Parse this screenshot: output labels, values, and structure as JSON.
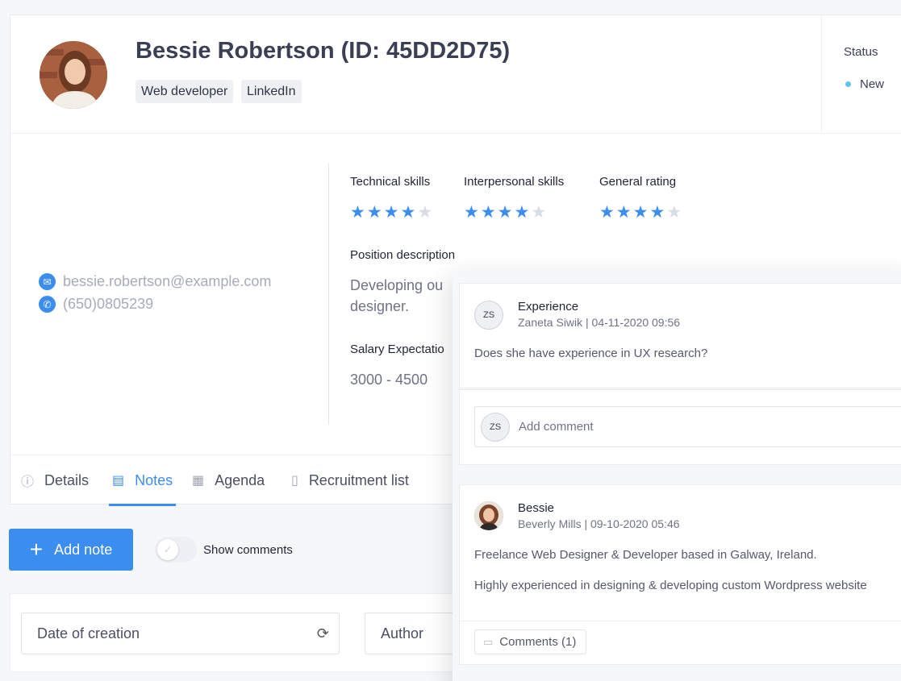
{
  "candidate": {
    "name": "Bessie Robertson (ID: 45DD2D75)",
    "tags": [
      "Web developer",
      "LinkedIn"
    ],
    "status_label": "Status",
    "status_value": "New",
    "status_color": "#5fc3f2",
    "email": "bessie.robertson@example.com",
    "phone": "(650)0805239"
  },
  "ratings": [
    {
      "label": "Technical skills",
      "value": 4,
      "max": 5
    },
    {
      "label": "Interpersonal skills",
      "value": 4,
      "max": 5
    },
    {
      "label": "General rating",
      "value": 4,
      "max": 5
    }
  ],
  "position": {
    "label": "Position description",
    "text_line1": "Developing ou",
    "text_line2": "designer."
  },
  "salary": {
    "label": "Salary Expectatio",
    "value": "3000 - 4500"
  },
  "tabs": [
    {
      "label": "Details",
      "icon": "info-icon"
    },
    {
      "label": "Notes",
      "icon": "document-icon",
      "active": true
    },
    {
      "label": "Agenda",
      "icon": "calendar-icon"
    },
    {
      "label": "Recruitment list",
      "icon": "clipboard-icon"
    }
  ],
  "toolbar": {
    "add_note_label": "Add note",
    "show_comments_label": "Show comments",
    "show_comments_on": false
  },
  "filters": {
    "date_label": "Date of creation",
    "author_label": "Author"
  },
  "notes": [
    {
      "initials": "ZS",
      "title": "Experience",
      "meta": "Zaneta Siwik | 04-11-2020 09:56",
      "body": "Does she have experience in UX research?",
      "comment_initials": "ZS",
      "comment_placeholder": "Add comment"
    },
    {
      "title": "Bessie",
      "meta": "Beverly Mills | 09-10-2020 05:46",
      "body1": "Freelance Web Designer & Developer based in Galway, Ireland.",
      "body2": "Highly experienced in designing & developing custom Wordpress website",
      "comments_label": "Comments (1)"
    }
  ],
  "colors": {
    "accent": "#3c8df0",
    "star_off": "#d8dce5"
  }
}
